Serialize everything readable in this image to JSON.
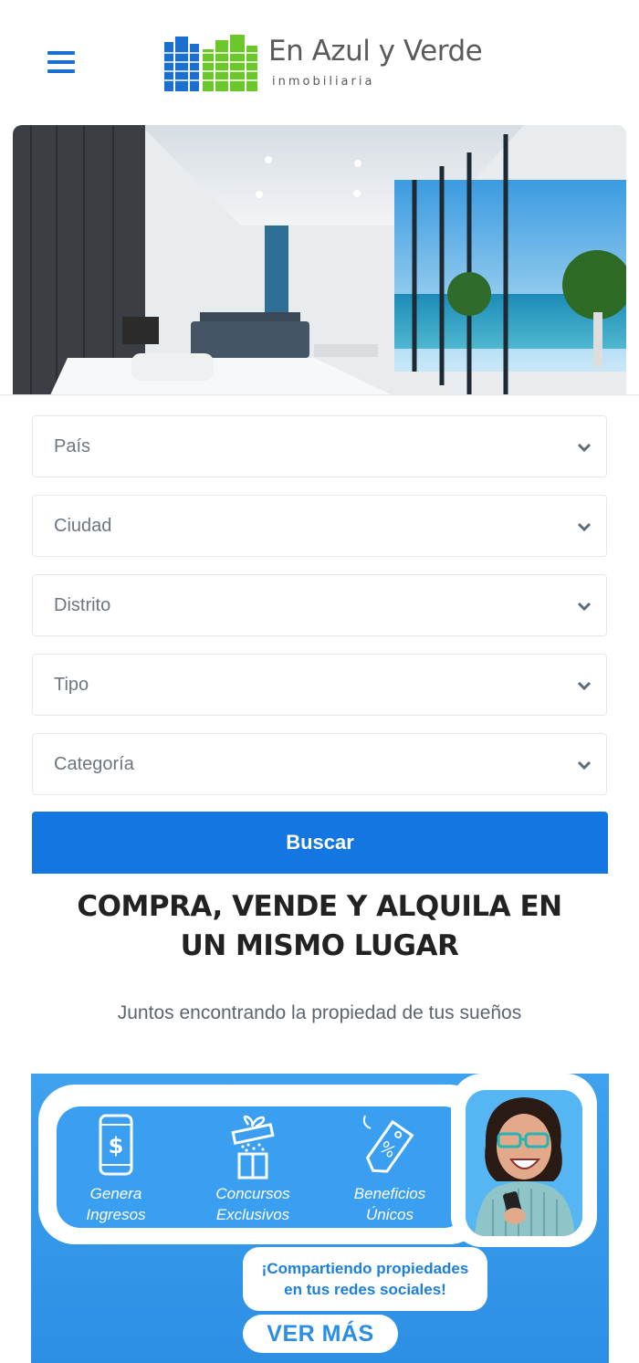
{
  "brand": {
    "name": "En Azul y Verde",
    "tagline": "inmobiliaria",
    "colors": {
      "blue": "#1a6fd1",
      "green": "#6cc72a",
      "button": "#1476e0"
    }
  },
  "header": {
    "menu_icon": "hamburger-icon"
  },
  "search": {
    "fields": [
      {
        "label": "País",
        "icon": "chevron-down-icon"
      },
      {
        "label": "Ciudad",
        "icon": "chevron-down-icon"
      },
      {
        "label": "Distrito",
        "icon": "chevron-down-icon"
      },
      {
        "label": "Tipo",
        "icon": "chevron-down-icon"
      },
      {
        "label": "Categoría",
        "icon": "chevron-down-icon"
      }
    ],
    "button_label": "Buscar"
  },
  "intro": {
    "headline_line1": "COMPRA, VENDE Y ALQUILA EN",
    "headline_line2": "UN MISMO LUGAR",
    "subheadline": "Juntos encontrando la propiedad de tus sueños"
  },
  "promo": {
    "benefits": [
      {
        "line1": "Genera",
        "line2": "Ingresos",
        "icon": "phone-dollar-icon"
      },
      {
        "line1": "Concursos",
        "line2": "Exclusivos",
        "icon": "gift-icon"
      },
      {
        "line1": "Beneficios",
        "line2": "Únicos",
        "icon": "discount-tag-icon"
      }
    ],
    "share_line1": "¡Compartiendo propiedades",
    "share_line2": "en tus redes sociales!",
    "cta_label": "VER MÁS"
  }
}
